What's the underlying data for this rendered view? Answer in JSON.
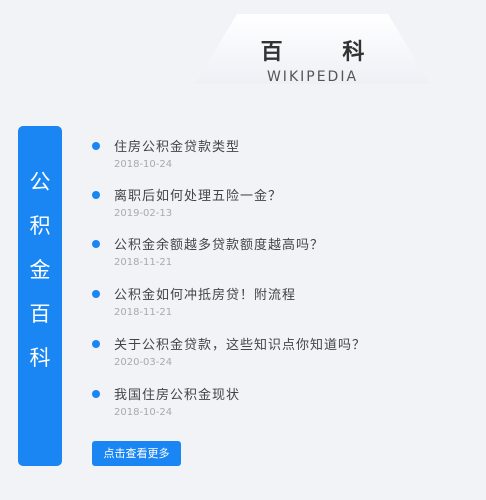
{
  "header": {
    "title": "百 科",
    "subtitle": "WIKIPEDIA"
  },
  "sidebar": {
    "chars": [
      "公",
      "积",
      "金",
      "百",
      "科"
    ]
  },
  "articles": [
    {
      "title": "住房公积金贷款类型",
      "date": "2018-10-24"
    },
    {
      "title": "离职后如何处理五险一金？",
      "date": "2019-02-13"
    },
    {
      "title": "公积金余额越多贷款额度越高吗？",
      "date": "2018-11-21"
    },
    {
      "title": "公积金如何冲抵房贷！附流程",
      "date": "2018-11-21"
    },
    {
      "title": "关于公积金贷款，这些知识点你知道吗？",
      "date": "2020-03-24"
    },
    {
      "title": "我国住房公积金现状",
      "date": "2018-10-24"
    }
  ],
  "more_button": {
    "label": "点击查看更多"
  },
  "colors": {
    "accent": "#1a86f3",
    "background": "#f2f3f7",
    "date": "#aaaaaa"
  }
}
